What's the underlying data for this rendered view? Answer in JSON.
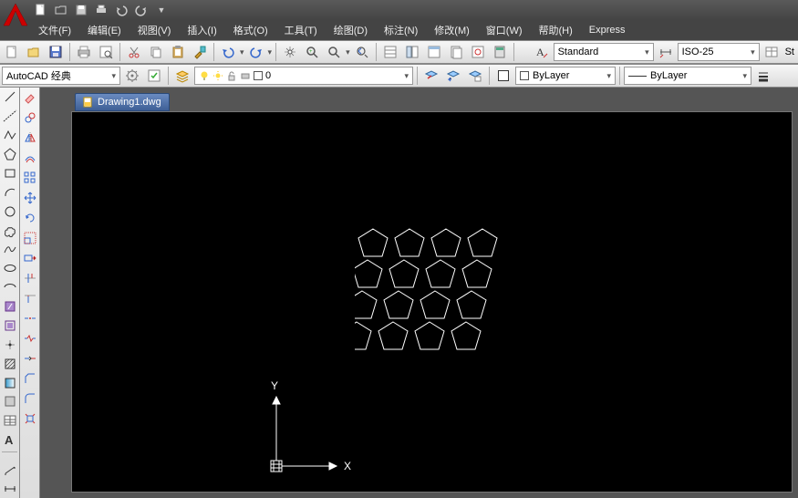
{
  "app": {
    "title_hidden": "AutoCAD"
  },
  "menus": {
    "file": "文件(F)",
    "edit": "编辑(E)",
    "view": "视图(V)",
    "insert": "插入(I)",
    "format": "格式(O)",
    "tools": "工具(T)",
    "draw": "绘图(D)",
    "dimension": "标注(N)",
    "modify": "修改(M)",
    "window": "窗口(W)",
    "help": "帮助(H)",
    "express": "Express"
  },
  "workspace": {
    "selected": "AutoCAD 经典"
  },
  "style": {
    "text_style": "Standard",
    "dim_style": "ISO-25",
    "other": "St"
  },
  "layer": {
    "current_label": "0",
    "lineweight": "ByLayer",
    "linetype": "ByLayer"
  },
  "doc": {
    "filename": "Drawing1.dwg"
  },
  "ucs": {
    "x_label": "X",
    "y_label": "Y"
  }
}
